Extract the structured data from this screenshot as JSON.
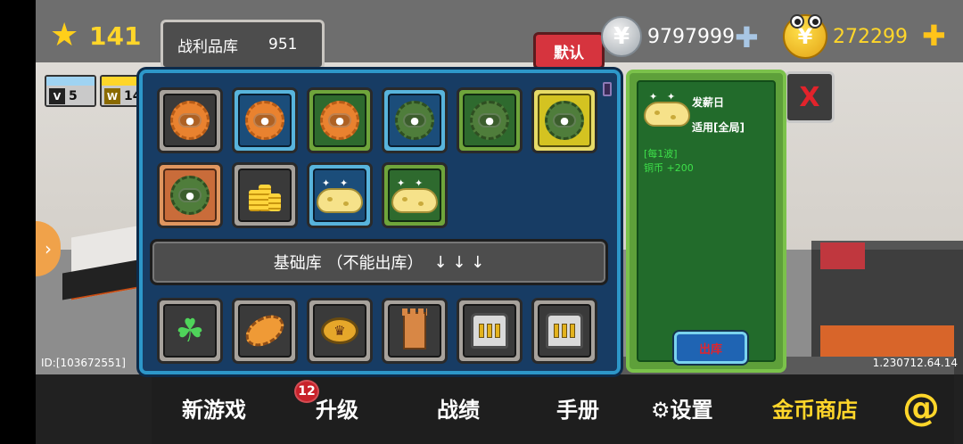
{
  "hud": {
    "stars": "141",
    "loot_tab_label": "战利品库",
    "loot_tab_count": "951",
    "default_button": "默认",
    "silver_symbol": "¥",
    "silver_amount": "9797999",
    "gold_symbol": "¥",
    "gold_amount": "272299",
    "close_glyph": "X",
    "level_badges": [
      {
        "value": "5",
        "icon": "V",
        "top_color": "#9fd3f2"
      },
      {
        "value": "14",
        "icon": "W",
        "top_color": "#ffd62a"
      }
    ]
  },
  "inventory": {
    "rows": [
      [
        {
          "icon": "orange-bottlecap-icon",
          "frame": "grey"
        },
        {
          "icon": "orange-bottlecap-icon",
          "frame": "blue"
        },
        {
          "icon": "orange-bottlecap-icon",
          "frame": "green"
        },
        {
          "icon": "green-bottlecap-icon",
          "frame": "blue"
        },
        {
          "icon": "green-bottlecap-icon",
          "frame": "green"
        },
        {
          "icon": "green-bottlecap-icon",
          "frame": "yellow"
        }
      ],
      [
        {
          "icon": "green-bottlecap-icon",
          "frame": "orange"
        },
        {
          "icon": "coin-stack-icon",
          "frame": "grey"
        },
        {
          "icon": "cheese-icon",
          "frame": "blue"
        },
        {
          "icon": "cheese-icon",
          "frame": "green"
        }
      ]
    ],
    "divider_label": "基础库 （不能出库）",
    "divider_arrows": "↓ ↓ ↓",
    "base_items": [
      {
        "icon": "clover-icon"
      },
      {
        "icon": "oval-coin-icon"
      },
      {
        "icon": "crown-coin-icon"
      },
      {
        "icon": "tower-icon"
      },
      {
        "icon": "safe-icon"
      },
      {
        "icon": "safe-icon"
      }
    ]
  },
  "detail": {
    "name": "发薪日",
    "scope": "适用[全局]",
    "effect_line1": "[每1波]",
    "effect_line2": "铜币 +200",
    "action_button": "出库"
  },
  "footer": {
    "id_text": "ID:[103672551]",
    "version": "1.230712.64.14"
  },
  "nav": {
    "new_game": "新游戏",
    "upgrade": "升级",
    "upgrade_badge": "12",
    "records": "战绩",
    "manual": "手册",
    "settings": "设置",
    "shop": "金币商店",
    "at": "@"
  },
  "colors": {
    "panel_blue": "#173c64",
    "panel_border": "#2d97c9",
    "detail_green": "#226b2b",
    "gold": "#ffd62a",
    "red": "#d6343e"
  }
}
